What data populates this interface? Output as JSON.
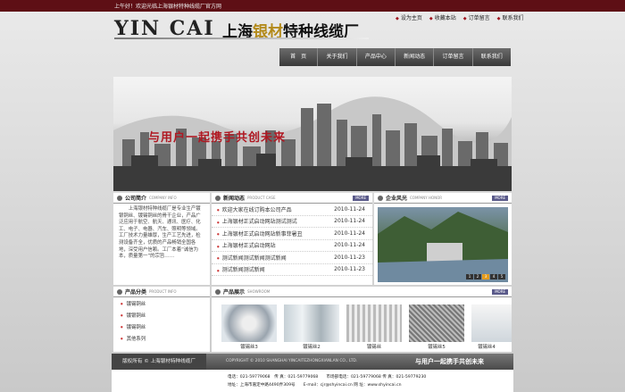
{
  "header": {
    "welcome": "上午好！欢迎光临上海银材特种线缆厂官方网",
    "logo_en": "YIN CAI",
    "logo_cn_prefix": "上海",
    "logo_cn_silver": "银材",
    "logo_cn_suffix": "特种线缆厂",
    "links": [
      "设为主页",
      "收藏本站",
      "订单留言",
      "联系我们"
    ]
  },
  "nav": [
    "首　页",
    "关于我们",
    "产品中心",
    "新闻动态",
    "订单留言",
    "联系我们"
  ],
  "banner": {
    "slogan": "与用户一起携手共创未来"
  },
  "company": {
    "title": "公司简介",
    "en": "COMPANY INFO",
    "text": "　　上海银材特种线缆厂是专业生产镀银铜丝、镀锡铜丝的骨干企业，产品广泛应用于航空、航天、通讯、医疗、化工、电子、电器、汽车、照明等领域。　　工厂技术力量雄厚，生产工艺先进，检测设备齐全，优质的产品畅销全国各地，深受用户信赖。工厂本着“诚信为本，质量第一”的宗旨……"
  },
  "news": {
    "title": "新闻动态",
    "en": "PRODUCT CASE",
    "more": "MORE",
    "items": [
      {
        "title": "欢迎大家在线订购本公司产品",
        "date": "2010-11-24"
      },
      {
        "title": "上海银材正式启动网站测试测试",
        "date": "2010-11-24"
      },
      {
        "title": "上海银材正式启动网站新事菲暑丑",
        "date": "2010-11-24"
      },
      {
        "title": "上海银材正式启动网站",
        "date": "2010-11-24"
      },
      {
        "title": "测试新闻测试新闻测试新闻",
        "date": "2010-11-23"
      },
      {
        "title": "测试新闻测试新闻",
        "date": "2010-11-23"
      }
    ]
  },
  "scenery": {
    "title": "企业风光",
    "en": "COMPANY HONOR",
    "more": "MORE",
    "pages": [
      "1",
      "2",
      "3",
      "4",
      "5"
    ],
    "active_page": 3
  },
  "categories": {
    "title": "产品分类",
    "en": "PRODUCT INFO",
    "items": [
      "镀锡铜丝",
      "镀银铜丝",
      "镀锡铜丝",
      "其他系列"
    ]
  },
  "products": {
    "title": "产品展示",
    "en": "SHOWROOM",
    "more": "MORE",
    "items": [
      "镀锡丝3",
      "镀锡丝2",
      "镀锡丝",
      "镀锡丝5",
      "镀锡丝4"
    ]
  },
  "footer": {
    "copyright_cn": "版权所有 © 上海银材特种线缆厂",
    "copyright_en": "COPYRIGHT © 2010 SHANGHAI YINCAITEZHONGXIANLAN CO., LTD.",
    "slogan": "与用户一起携手共创未来",
    "line1": "电话：021-59779068　传 真：021-59779068　　市场部电话：021-59779068 传 真：021-59779230",
    "line2": "地址：上海市嘉定中路4490弄309号　　E-mail：cjr@shyincai.cn 网 址：www.shyincai.cn"
  },
  "colors": {
    "topbar": "#5e0f15",
    "accent": "#b01822",
    "gold": "#b38a1a"
  }
}
